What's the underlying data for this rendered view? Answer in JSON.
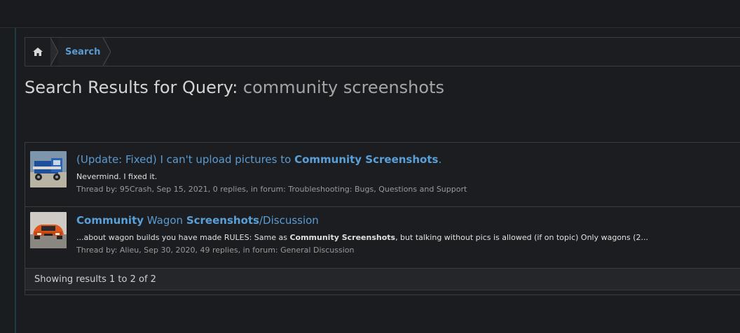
{
  "breadcrumb": {
    "home_icon": "home-icon",
    "search_label": "Search"
  },
  "title": {
    "prefix": "Search Results for Query:",
    "query": "community screenshots"
  },
  "results": [
    {
      "thumb_icon": "truck-avatar",
      "title_pre": "(Update: Fixed) I can't upload pictures to ",
      "title_bold1": "Community Screenshots",
      "title_mid": "",
      "title_bold2": "",
      "title_post": ".",
      "snippet_pre": "Nevermind. I fixed it.",
      "snippet_bold": "",
      "snippet_post": "",
      "meta_prefix": "Thread by: ",
      "author": "95Crash",
      "meta_mid": ", Sep 15, 2021, 0 replies, in forum: ",
      "forum": "Troubleshooting: Bugs, Questions and Support"
    },
    {
      "thumb_icon": "car-avatar",
      "title_pre": "",
      "title_bold1": "Community",
      "title_mid": " Wagon ",
      "title_bold2": "Screenshots",
      "title_post": "/Discussion",
      "snippet_pre": "...about wagon builds you have made RULES: Same as ",
      "snippet_bold": "Community Screenshots",
      "snippet_post": ", but talking without pics is allowed (if on topic) Only wagons (2...",
      "meta_prefix": "Thread by: ",
      "author": "Alieu",
      "meta_mid": ", Sep 30, 2020, 49 replies, in forum: ",
      "forum": "General Discussion"
    }
  ],
  "footer": {
    "showing": "Showing results 1 to 2 of 2"
  },
  "colors": {
    "link": "#5b9bd1",
    "background": "#1b1c1f",
    "border": "#3a3c40"
  }
}
